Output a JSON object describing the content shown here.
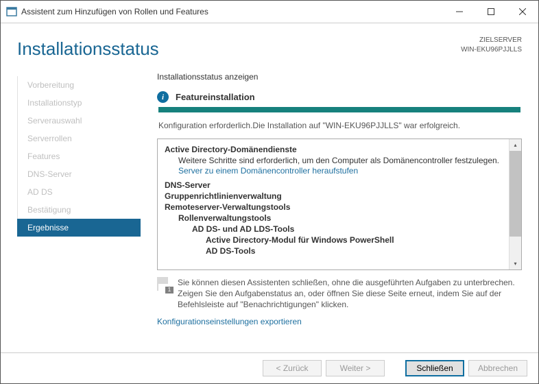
{
  "window": {
    "title": "Assistent zum Hinzufügen von Rollen und Features"
  },
  "header": {
    "page_title": "Installationsstatus",
    "target_label": "ZIELSERVER",
    "target_name": "WIN-EKU96PJJLLS"
  },
  "sidebar": {
    "items": [
      {
        "label": "Vorbereitung",
        "active": false
      },
      {
        "label": "Installationstyp",
        "active": false
      },
      {
        "label": "Serverauswahl",
        "active": false
      },
      {
        "label": "Serverrollen",
        "active": false
      },
      {
        "label": "Features",
        "active": false
      },
      {
        "label": "DNS-Server",
        "active": false
      },
      {
        "label": "AD DS",
        "active": false
      },
      {
        "label": "Bestätigung",
        "active": false
      },
      {
        "label": "Ergebnisse",
        "active": true
      }
    ]
  },
  "main": {
    "section_label": "Installationsstatus anzeigen",
    "status_title": "Featureinstallation",
    "result_message": "Konfiguration erforderlich.Die Installation auf \"WIN-EKU96PJJLLS\" war erfolgreich.",
    "tree": {
      "adds_header": "Active Directory-Domänendienste",
      "adds_text": "Weitere Schritte sind erforderlich, um den Computer als Domänencontroller festzulegen.",
      "adds_link": "Server zu einem Domänencontroller heraufstufen",
      "dns_header": "DNS-Server",
      "gpo_header": "Gruppenrichtlinienverwaltung",
      "rsat_header": "Remoteserver-Verwaltungstools",
      "rsat_roles": "Rollenverwaltungstools",
      "adlds": "AD DS- und AD LDS-Tools",
      "psmod": "Active Directory-Modul für Windows PowerShell",
      "adtools": "AD DS-Tools"
    },
    "hint_text": "Sie können diesen Assistenten schließen, ohne die ausgeführten Aufgaben zu unterbrechen. Zeigen Sie den Aufgabenstatus an, oder öffnen Sie diese Seite erneut, indem Sie auf der Befehlsleiste auf \"Benachrichtigungen\" klicken.",
    "hint_badge": "1",
    "export_link": "Konfigurationseinstellungen exportieren"
  },
  "footer": {
    "back": "< Zurück",
    "next": "Weiter >",
    "close": "Schließen",
    "cancel": "Abbrechen"
  }
}
